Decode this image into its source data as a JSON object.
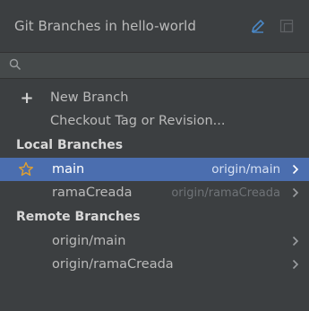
{
  "header": {
    "title": "Git Branches in hello-world",
    "icons": [
      "pencil-icon",
      "restore-icon"
    ]
  },
  "search": {
    "placeholder": "",
    "value": ""
  },
  "actions": [
    {
      "label": "New Branch",
      "icon": "plus-icon"
    },
    {
      "label": "Checkout Tag or Revision..."
    }
  ],
  "local": {
    "heading": "Local Branches",
    "items": [
      {
        "name": "main",
        "remote": "origin/main",
        "favorite": true,
        "selected": true
      },
      {
        "name": "ramaCreada",
        "remote": "origin/ramaCreada",
        "favorite": false,
        "selected": false
      }
    ]
  },
  "remote": {
    "heading": "Remote Branches",
    "items": [
      {
        "name": "origin/main"
      },
      {
        "name": "origin/ramaCreada"
      }
    ]
  },
  "colors": {
    "background": "#3c3f41",
    "selection": "#4b6eaf",
    "star": "#e0a030",
    "pencil": "#4a88c7"
  }
}
